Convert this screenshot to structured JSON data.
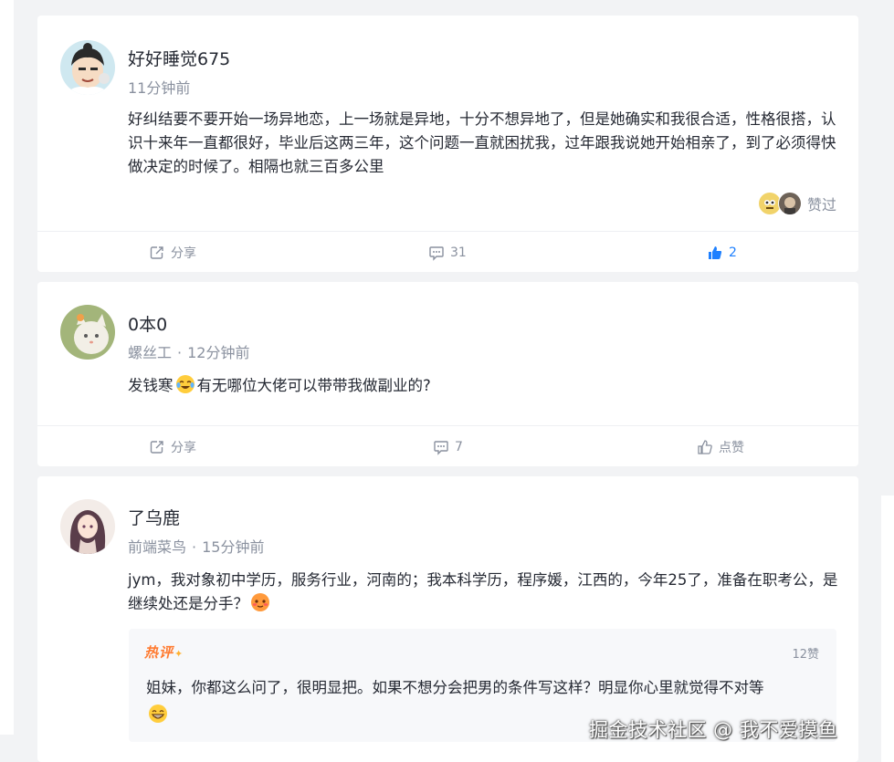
{
  "posts": [
    {
      "author": "好好睡觉675",
      "time": "11分钟前",
      "content": "好纠结要不要开始一场异地恋，上一场就是异地，十分不想异地了，但是她确实和我很合适，性格很搭，认识十来年一直都很好，毕业后这两三年，这个问题一直就困扰我，过年跟我说她开始相亲了，到了必须得快做决定的时候了。相隔也就三百多公里",
      "liked_by_label": "赞过",
      "actions": {
        "share": "分享",
        "comments": "31",
        "likes": "2"
      }
    },
    {
      "author": "0本0",
      "title": "螺丝工",
      "time": "12分钟前",
      "content_before_emoji": "发钱寒",
      "content_after_emoji": "有无哪位大佬可以带带我做副业的?",
      "actions": {
        "share": "分享",
        "comments": "7",
        "likes": "点赞"
      }
    },
    {
      "author": "了乌鹿",
      "title": "前端菜鸟",
      "time": "15分钟前",
      "content": "jym，我对象初中学历，服务行业，河南的；我本科学历，程序媛，江西的，今年25了，准备在职考公，是继续处还是分手？",
      "hot_comment": {
        "badge": "热评",
        "likes": "12赞",
        "text": "姐妹，你都这么问了，很明显把。如果不想分会把男的条件写这样？明显你心里就觉得不对等"
      }
    }
  ],
  "icons": {
    "share": "share-icon",
    "comment": "comment-icon",
    "like": "thumb-up-icon",
    "emoji_cry": "crying-laughing-emoji-icon",
    "emoji_blush": "embarrassed-emoji-icon",
    "emoji_grin": "grinning-emoji-icon"
  },
  "colors": {
    "accent": "#1e80ff",
    "secondary_text": "#8a919f",
    "hot": "#ff7a2f"
  },
  "watermark": "掘金技术社区 @ 我不爱摸鱼"
}
